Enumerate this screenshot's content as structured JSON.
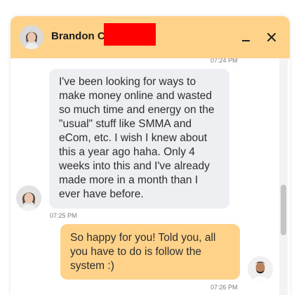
{
  "header": {
    "contact_name": "Brandon C",
    "minimize_icon": "minimize-icon",
    "close_icon": "close-icon",
    "colors": {
      "header_bg": "#ffd28a",
      "redaction": "#ff0000"
    }
  },
  "messages": [
    {
      "direction": "incoming",
      "timestamp_above": "07:24 PM",
      "text": "I've been looking for ways to\nmake money online and wasted\nso much time and energy on the\n\"usual\" stuff like SMMA and\neCom, etc. I wish I knew about\nthis a year ago haha. Only 4\nweeks into this and I've already\nmade more in a month than I\never have before.",
      "timestamp": "07:25 PM"
    },
    {
      "direction": "outgoing",
      "text": "So happy for you! Told you, all\nyou have to do is follow the\nsystem :)",
      "timestamp": "07:26 PM"
    }
  ],
  "colors": {
    "incoming_bubble": "#eeeff2",
    "outgoing_bubble": "#ffd28a",
    "timestamp": "#7a7a7a"
  }
}
